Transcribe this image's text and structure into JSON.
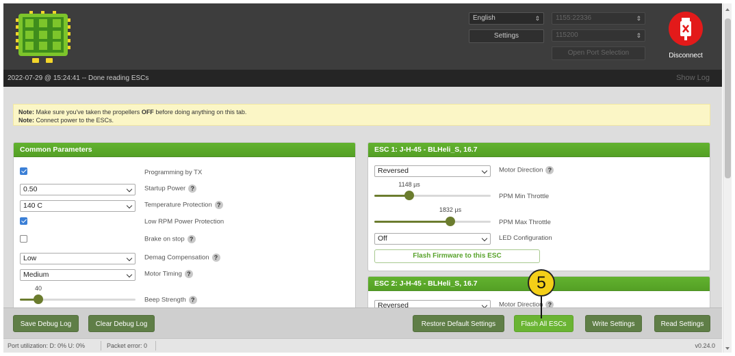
{
  "header": {
    "language": "English",
    "settings_label": "Settings",
    "port": "1155:22336",
    "baud": "115200",
    "open_port_label": "Open Port Selection",
    "disconnect_label": "Disconnect"
  },
  "status": {
    "log_line": "2022-07-29 @ 15:24:41 -- Done reading ESCs",
    "show_log": "Show Log"
  },
  "note": {
    "line1_prefix": "Note:",
    "line1_a": " Make sure you've taken the propellers ",
    "line1_bold": "OFF",
    "line1_b": " before doing anything on this tab.",
    "line2_prefix": "Note:",
    "line2_text": " Connect power to the ESCs."
  },
  "common": {
    "title": "Common Parameters",
    "programming_by_tx": "Programming by TX",
    "startup_power_value": "0.50",
    "startup_power_label": "Startup Power",
    "temp_protection_value": "140 C",
    "temp_protection_label": "Temperature Protection",
    "low_rpm_label": "Low RPM Power Protection",
    "brake_on_stop_label": "Brake on stop",
    "demag_value": "Low",
    "demag_label": "Demag Compensation",
    "timing_value": "Medium",
    "timing_label": "Motor Timing",
    "beep_value": "40",
    "beep_label": "Beep Strength",
    "beep_fraction": 0.16,
    "programming_by_tx_checked": true,
    "low_rpm_checked": true,
    "brake_on_stop_checked": false
  },
  "esc1": {
    "title": "ESC 1: J-H-45 - BLHeli_S, 16.7",
    "direction_value": "Reversed",
    "direction_label": "Motor Direction",
    "ppm_min_value": "1148 µs",
    "ppm_min_label": "PPM Min Throttle",
    "ppm_min_fraction": 0.3,
    "ppm_max_value": "1832 µs",
    "ppm_max_label": "PPM Max Throttle",
    "ppm_max_fraction": 0.65,
    "led_value": "Off",
    "led_label": "LED Configuration",
    "flash_label": "Flash Firmware to this ESC"
  },
  "esc2": {
    "title": "ESC 2: J-H-45 - BLHeli_S, 16.7",
    "direction_value": "Reversed",
    "direction_label": "Motor Direction"
  },
  "toolbar": {
    "save_debug": "Save Debug Log",
    "clear_debug": "Clear Debug Log",
    "restore_defaults": "Restore Default Settings",
    "flash_all": "Flash All ESCs",
    "write_settings": "Write Settings",
    "read_settings": "Read Settings"
  },
  "footer": {
    "port_util": "Port utilization: D: 0% U: 0%",
    "packet_error": "Packet error: 0",
    "version": "v0.24.0"
  },
  "annotation": {
    "step": "5"
  },
  "icon_names": [
    "esc-board-logo-icon",
    "usb-disconnect-icon",
    "help-icon",
    "chevron-down-icon"
  ],
  "colors": {
    "panel_header": "#59aa29",
    "flash_all_active": "#6ab433",
    "toolbar_button": "#5f7e47",
    "disconnect": "#e31a1a",
    "slider": "#6b7c2e",
    "note_bg": "#fbf6c6"
  }
}
